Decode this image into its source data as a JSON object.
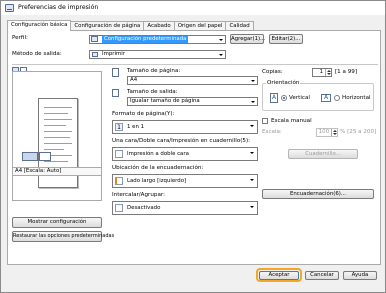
{
  "window": {
    "title": "Preferencias de impresión"
  },
  "tabs": [
    {
      "label": "Configuración básica"
    },
    {
      "label": "Configuración de página"
    },
    {
      "label": "Acabado"
    },
    {
      "label": "Origen del papel"
    },
    {
      "label": "Calidad"
    }
  ],
  "profile": {
    "label": "Perfil:",
    "value": "Configuración predeterminada",
    "add_button": "Agregar(1)...",
    "edit_button": "Editar(2)..."
  },
  "output": {
    "label": "Método de salida:",
    "value": "Imprimir"
  },
  "preview": {
    "caption": "A4 [Escala: Auto]"
  },
  "page_size": {
    "label": "Tamaño de página:",
    "value": "A4"
  },
  "output_size": {
    "label": "Tamaño de salida:",
    "value": "Igualar tamaño de página"
  },
  "copies": {
    "label": "Copias:",
    "value": "1",
    "range": "[1 a 99]"
  },
  "orientation": {
    "label": "Orientación",
    "vertical": "Vertical",
    "horizontal": "Horizontal",
    "selected": "vertical"
  },
  "manual_scale": {
    "label": "Escala manual",
    "checked": false,
    "scale_label": "Escala:",
    "scale_value": "100",
    "scale_range": "% [25 a 200]"
  },
  "page_layout": {
    "label": "Formato de página(Y):",
    "value": "1 en 1"
  },
  "duplex": {
    "label": "Una cara/Doble cara/Impresión en cuadernillo(5):",
    "value": "Impresión a doble cara"
  },
  "booklet_button": "Cuadernillo...",
  "binding": {
    "label": "Ubicación de la encuadernación:",
    "value": "Lado largo [izquierdo]",
    "button": "Encuadernación(6)..."
  },
  "collate": {
    "label": "Intercalar/Agrupar:",
    "value": "Desactivado"
  },
  "left_buttons": {
    "show_settings": "Mostrar configuración",
    "restore_defaults": "Restaurar las opciones predeterminadas"
  },
  "footer": {
    "ok": "Aceptar",
    "cancel": "Cancelar",
    "help": "Ayuda"
  },
  "colors": {
    "accent": "#3399ff",
    "highlight_ring": "#f5a623"
  }
}
